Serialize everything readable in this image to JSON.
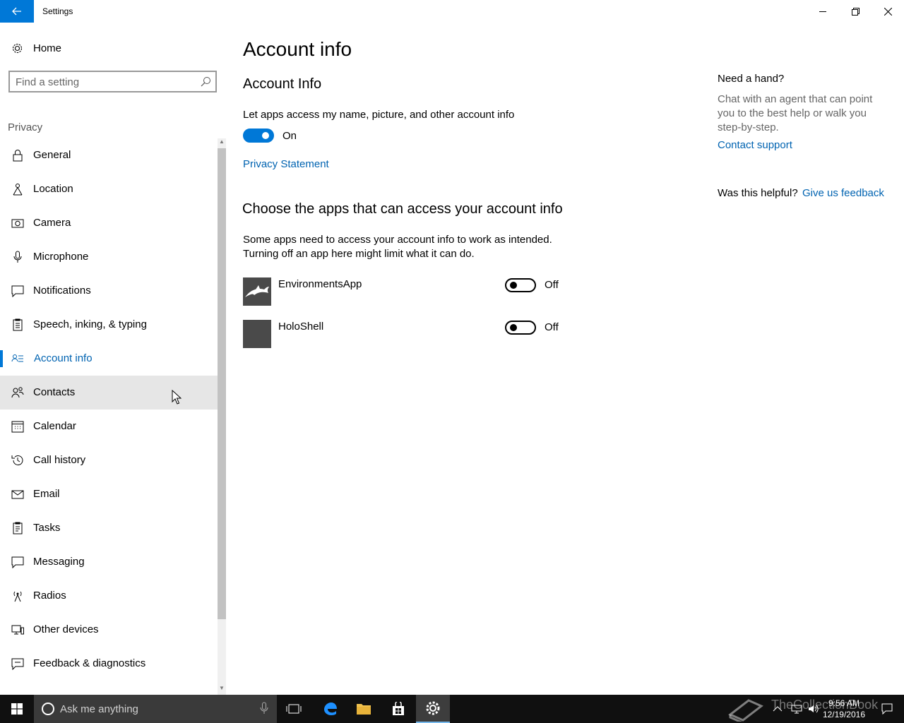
{
  "window": {
    "title": "Settings",
    "accent": "#0078d7"
  },
  "sidebar": {
    "home_label": "Home",
    "search_placeholder": "Find a setting",
    "section_label": "Privacy",
    "items": [
      {
        "label": "General",
        "icon": "lock-icon"
      },
      {
        "label": "Location",
        "icon": "location-icon"
      },
      {
        "label": "Camera",
        "icon": "camera-icon"
      },
      {
        "label": "Microphone",
        "icon": "microphone-icon"
      },
      {
        "label": "Notifications",
        "icon": "notifications-icon"
      },
      {
        "label": "Speech, inking, & typing",
        "icon": "speech-icon"
      },
      {
        "label": "Account info",
        "icon": "account-info-icon",
        "selected": true
      },
      {
        "label": "Contacts",
        "icon": "contacts-icon",
        "hover": true
      },
      {
        "label": "Calendar",
        "icon": "calendar-icon"
      },
      {
        "label": "Call history",
        "icon": "history-icon"
      },
      {
        "label": "Email",
        "icon": "email-icon"
      },
      {
        "label": "Tasks",
        "icon": "tasks-icon"
      },
      {
        "label": "Messaging",
        "icon": "messaging-icon"
      },
      {
        "label": "Radios",
        "icon": "radios-icon"
      },
      {
        "label": "Other devices",
        "icon": "devices-icon"
      },
      {
        "label": "Feedback & diagnostics",
        "icon": "feedback-icon"
      }
    ]
  },
  "main": {
    "page_title": "Account info",
    "sub_title": "Account Info",
    "access_description": "Let apps access my name, picture, and other account info",
    "access_toggle_state": "On",
    "privacy_link": "Privacy Statement",
    "apps_section_title": "Choose the apps that can access your account info",
    "apps_section_desc_1": "Some apps need to access your account info to work as intended.",
    "apps_section_desc_2": "Turning off an app here might limit what it can do.",
    "apps": [
      {
        "name": "EnvironmentsApp",
        "state": "Off"
      },
      {
        "name": "HoloShell",
        "state": "Off"
      }
    ]
  },
  "help": {
    "title": "Need a hand?",
    "text": "Chat with an agent that can point you to the best help or walk you step-by-step.",
    "contact_link": "Contact support",
    "helpful_question": "Was this helpful?",
    "feedback_link": "Give us feedback"
  },
  "taskbar": {
    "search_placeholder": "Ask me anything",
    "time": "9:56 AM",
    "date": "12/19/2016",
    "watermark": "TheCollectionBook"
  }
}
